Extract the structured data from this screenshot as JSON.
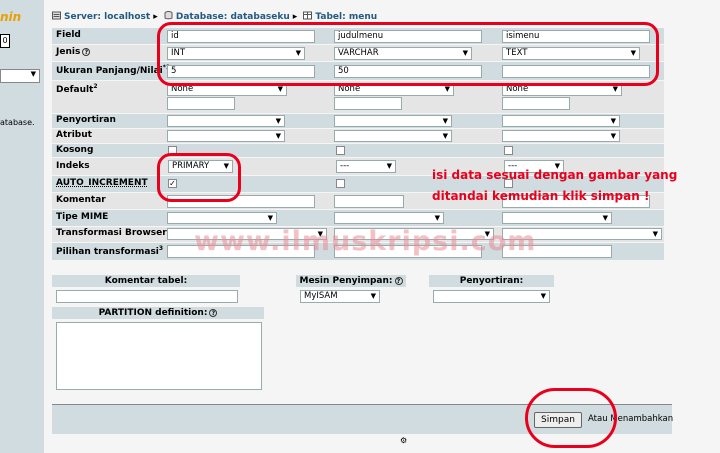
{
  "sidebar": {
    "logo": "nin",
    "box": "0",
    "text": "atabase."
  },
  "breadcrumb": {
    "server": "Server: localhost",
    "database": "Database: databaseku",
    "table": "Tabel: menu"
  },
  "labels": {
    "field": "Field",
    "type": "Jenis",
    "length": "Ukuran Panjang/Nilai",
    "length_sup": "*1",
    "default": "Default",
    "default_sup": "2",
    "collation": "Penyortiran",
    "attributes": "Atribut",
    "null": "Kosong",
    "index": "Indeks",
    "auto_increment": "AUTO_INCREMENT",
    "comments": "Komentar",
    "mime": "Tipe MIME",
    "transformation": "Transformasi Browser",
    "transformation_options": "Pilihan transformasi",
    "transformation_options_sup": "3"
  },
  "columns": [
    {
      "field": "id",
      "type": "INT",
      "length": "5",
      "default": "None",
      "index": "PRIMARY",
      "auto_increment": true
    },
    {
      "field": "judulmenu",
      "type": "VARCHAR",
      "length": "50",
      "default": "None",
      "index": "---",
      "auto_increment": false
    },
    {
      "field": "isimenu",
      "type": "TEXT",
      "length": "",
      "default": "None",
      "index": "---",
      "auto_increment": false
    }
  ],
  "annotation": {
    "line1": "isi data sesuai dengan gambar yang",
    "line2": "ditandai kemudian klik simpan !"
  },
  "watermark": "www.ilmuskripsi.com",
  "bottom": {
    "table_comment": "Komentar tabel:",
    "storage_engine": "Mesin Penyimpan:",
    "engine_value": "MyISAM",
    "collation": "Penyortiran:",
    "partition": "PARTITION definition:"
  },
  "footer": {
    "save": "Simpan",
    "or_add": "Atau Menambahkan"
  },
  "colors": {
    "annotation": "#e8001c",
    "row_blue": "#d0dce0",
    "row_gray": "#e5e5e5",
    "link": "#235a81"
  }
}
